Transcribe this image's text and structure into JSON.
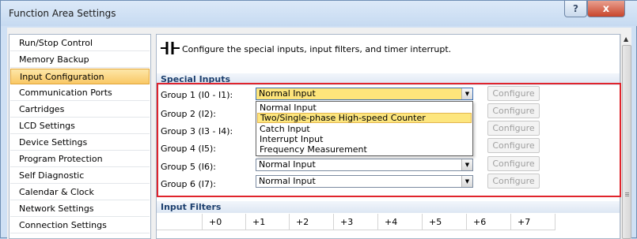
{
  "window": {
    "title": "Function Area Settings",
    "help_glyph": "?",
    "close_glyph": "x"
  },
  "sidebar": {
    "items": [
      {
        "label": "Run/Stop Control"
      },
      {
        "label": "Memory Backup"
      },
      {
        "label": "Input Configuration"
      },
      {
        "label": "Communication Ports"
      },
      {
        "label": "Cartridges"
      },
      {
        "label": "LCD Settings"
      },
      {
        "label": "Device Settings"
      },
      {
        "label": "Program Protection"
      },
      {
        "label": "Self Diagnostic"
      },
      {
        "label": "Calendar & Clock"
      },
      {
        "label": "Network Settings"
      },
      {
        "label": "Connection Settings"
      }
    ],
    "active_index": 2
  },
  "main": {
    "description": "Configure the special inputs, input filters, and timer interrupt.",
    "special_inputs": {
      "header": "Special Inputs",
      "configure_label": "Configure",
      "groups": [
        {
          "label": "Group 1 (I0 - I1):",
          "value": "Normal Input"
        },
        {
          "label": "Group 2 (I2):",
          "value": ""
        },
        {
          "label": "Group 3 (I3 - I4):",
          "value": ""
        },
        {
          "label": "Group 4 (I5):",
          "value": ""
        },
        {
          "label": "Group 5 (I6):",
          "value": "Normal Input"
        },
        {
          "label": "Group 6 (I7):",
          "value": "Normal Input"
        }
      ],
      "dropdown_options": [
        "Normal Input",
        "Two/Single-phase High-speed Counter",
        "Catch Input",
        "Interrupt Input",
        "Frequency Measurement"
      ],
      "dropdown_selected_index": 1
    },
    "input_filters": {
      "header": "Input Filters",
      "columns": [
        "+0",
        "+1",
        "+2",
        "+3",
        "+4",
        "+5",
        "+6",
        "+7"
      ]
    }
  },
  "colors": {
    "accent_highlight": "#fde67e",
    "active_item": "#f9c865",
    "red_outline": "#e0242c",
    "header_text": "#1c3f6e"
  }
}
